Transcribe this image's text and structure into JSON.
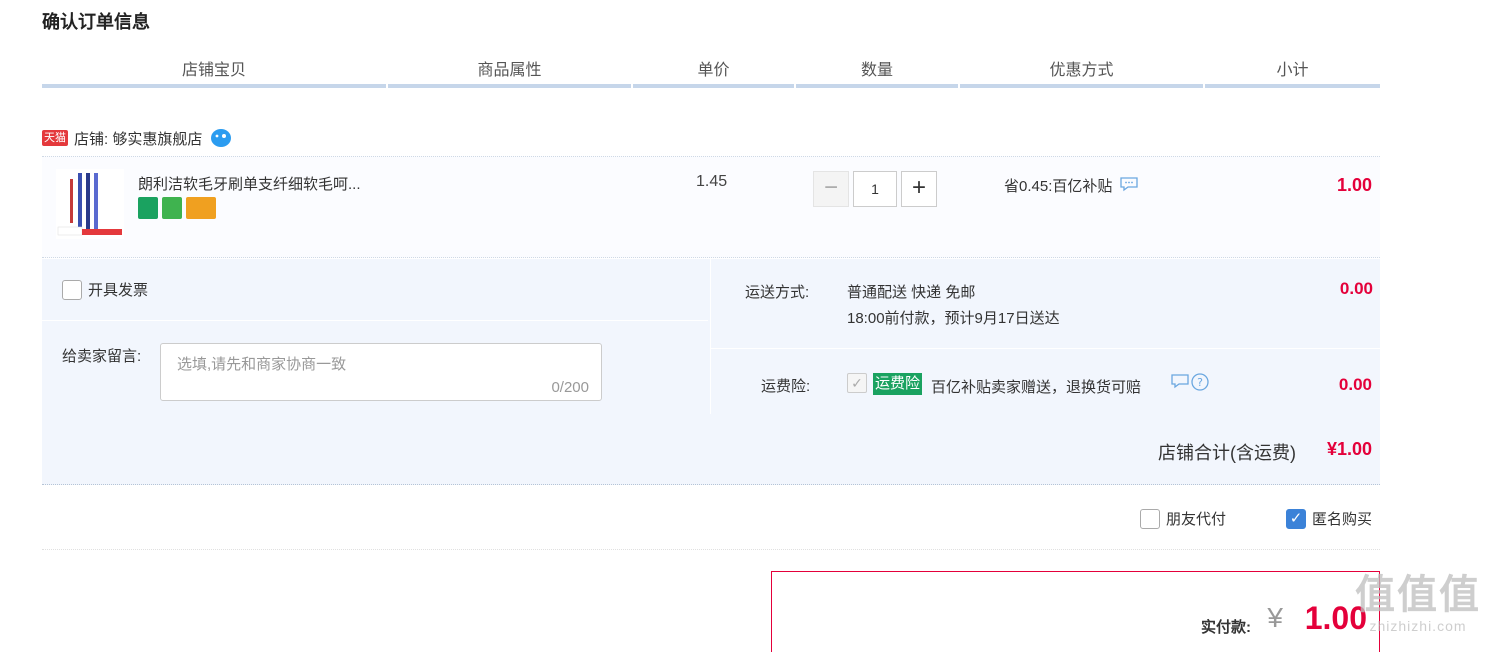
{
  "page_title": "确认订单信息",
  "columns": [
    "店铺宝贝",
    "商品属性",
    "单价",
    "数量",
    "优惠方式",
    "小计"
  ],
  "shop": {
    "badge": "天猫",
    "label": "店铺: 够实惠旗舰店"
  },
  "item": {
    "title": "朗利洁软毛牙刷单支纤细软毛呵...",
    "unit_price": "1.45",
    "quantity": "1",
    "discount": "省0.45:百亿补贴",
    "subtotal": "1.00"
  },
  "invoice": {
    "label": "开具发票"
  },
  "memo": {
    "label": "给卖家留言:",
    "placeholder": "选填,请先和商家协商一致",
    "counter": "0/200"
  },
  "shipping": {
    "label": "运送方式:",
    "method": "普通配送 快递 免邮",
    "eta": "18:00前付款，预计9月17日送达",
    "fee": "0.00"
  },
  "insurance": {
    "label": "运费险:",
    "tag": "运费险",
    "desc": "百亿补贴卖家赠送，退换货可赔",
    "fee": "0.00"
  },
  "shop_total": {
    "label": "店铺合计(含运费)",
    "value": "¥1.00"
  },
  "options": {
    "friend_pay": "朋友代付",
    "anonymous": "匿名购买"
  },
  "payment": {
    "label": "实付款:",
    "currency": "¥",
    "amount": "1.00"
  },
  "watermark": {
    "glyphs": "值值值",
    "domain": "zhizhizhi.com"
  },
  "colors": {
    "price_red": "#e4003a",
    "header_rule": "#c6d6ea",
    "panel_bg": "#f2f6fd",
    "checkbox_blue": "#3b82d8",
    "insurance_green": "#1aa260"
  }
}
